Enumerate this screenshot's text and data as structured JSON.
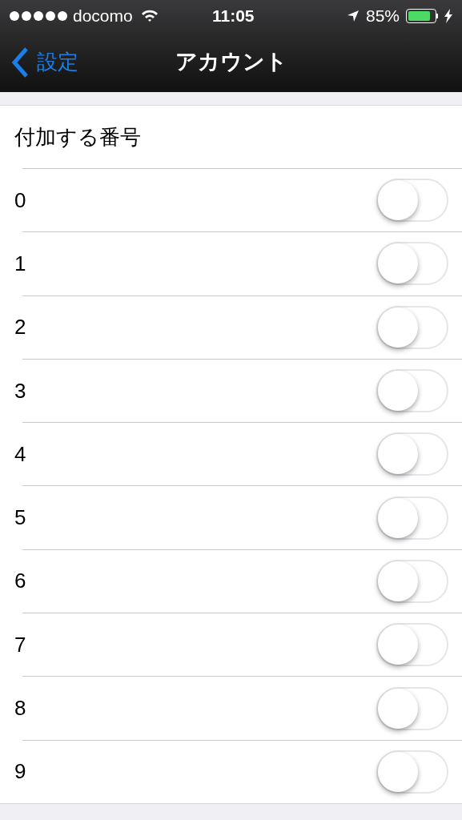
{
  "status_bar": {
    "carrier": "docomo",
    "time": "11:05",
    "battery": "85%"
  },
  "nav": {
    "back": "設定",
    "title": "アカウント"
  },
  "section": {
    "header": "付加する番号",
    "rows": [
      {
        "label": "0",
        "on": false
      },
      {
        "label": "1",
        "on": false
      },
      {
        "label": "2",
        "on": false
      },
      {
        "label": "3",
        "on": false
      },
      {
        "label": "4",
        "on": false
      },
      {
        "label": "5",
        "on": false
      },
      {
        "label": "6",
        "on": false
      },
      {
        "label": "7",
        "on": false
      },
      {
        "label": "8",
        "on": false
      },
      {
        "label": "9",
        "on": false
      }
    ]
  }
}
